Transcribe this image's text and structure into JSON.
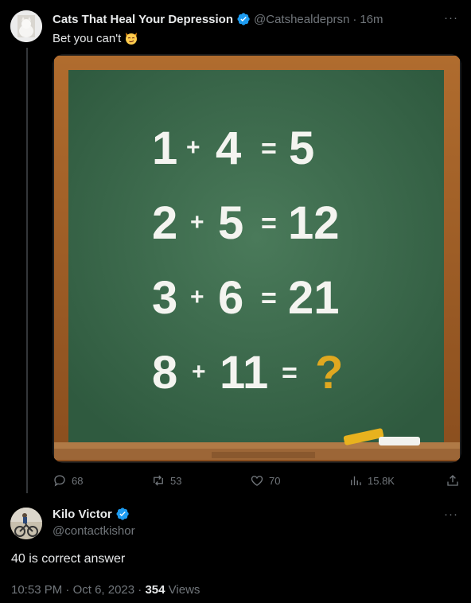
{
  "tweet": {
    "author_name": "Cats That Heal Your Depression",
    "handle": "@Catshealdeprsn",
    "separator": "·",
    "time": "16m",
    "text": "Bet you can't",
    "emoji": "smirking-cat-emoji",
    "more_label": "···",
    "media": {
      "equations": [
        {
          "a": "1",
          "b": "4",
          "result": "5"
        },
        {
          "a": "2",
          "b": "5",
          "result": "12"
        },
        {
          "a": "3",
          "b": "6",
          "result": "21"
        },
        {
          "a": "8",
          "b": "11",
          "result": "?"
        }
      ]
    },
    "actions": {
      "replies": "68",
      "reposts": "53",
      "likes": "70",
      "views": "15.8K"
    }
  },
  "reply": {
    "author_name": "Kilo Victor",
    "handle": "@contactkishor",
    "more_label": "···",
    "text": "40 is correct answer",
    "time": "10:53 PM",
    "separator": "·",
    "date": "Oct 6, 2023",
    "views_count": "354",
    "views_label": "Views"
  },
  "colors": {
    "background": "#000000",
    "muted": "#71767b",
    "verified": "#1d9bf0",
    "board": "#3f6b4f",
    "frame": "#a0622c",
    "chalk_yellow": "#e0a820"
  }
}
